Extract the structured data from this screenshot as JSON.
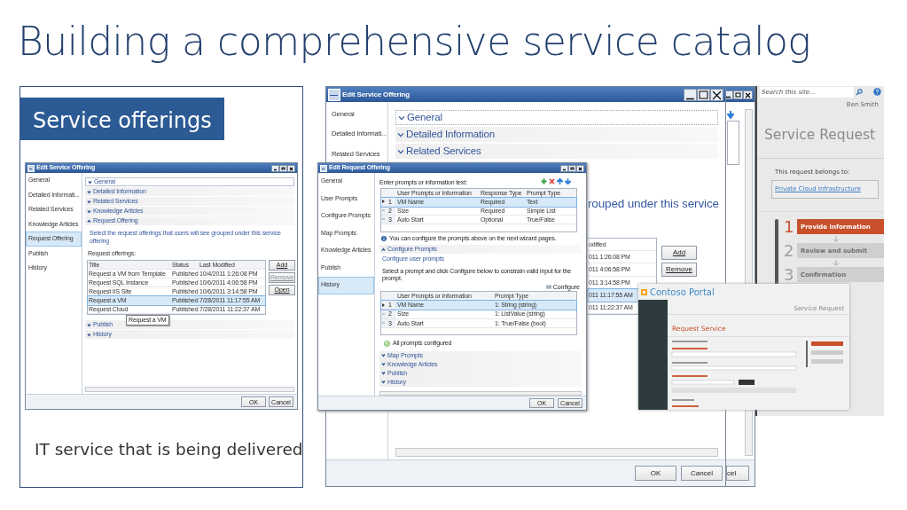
{
  "slide": {
    "title": "Building a comprehensive service catalog"
  },
  "offerings_panel": {
    "heading": "Service offerings",
    "caption": "IT service that is being delivered",
    "window": {
      "title": "Edit Service Offering",
      "nav": [
        {
          "label": "General",
          "selected": false
        },
        {
          "label": "Detailed Informati...",
          "selected": false
        },
        {
          "label": "Related Services",
          "selected": false
        },
        {
          "label": "Knowledge Articles",
          "selected": false
        },
        {
          "label": "Request Offering",
          "selected": true
        },
        {
          "label": "Publish",
          "selected": false
        },
        {
          "label": "History",
          "selected": false
        }
      ],
      "sections": [
        {
          "label": "General",
          "expanded": false
        },
        {
          "label": "Detailed Information",
          "expanded": false
        },
        {
          "label": "Related Services",
          "expanded": false
        },
        {
          "label": "Knowledge Articles",
          "expanded": false
        },
        {
          "label": "Request Offering",
          "expanded": true
        },
        {
          "label": "Publish",
          "expanded": false
        },
        {
          "label": "History",
          "expanded": false
        }
      ],
      "description": "Select the request offerings that users will see grouped under this service offering",
      "list_label": "Request offerings:",
      "columns": [
        "Title",
        "Status",
        "Last Modified"
      ],
      "rows": [
        {
          "cells": [
            "Request a VM from Template",
            "Published",
            "10/4/2011 1:26:08 PM"
          ],
          "selected": false
        },
        {
          "cells": [
            "Request SQL Instance",
            "Published",
            "10/6/2011 4:06:58 PM"
          ],
          "selected": false
        },
        {
          "cells": [
            "Request IIS Site",
            "Published",
            "10/6/2011 3:14:58 PM"
          ],
          "selected": false
        },
        {
          "cells": [
            "Request a VM",
            "Published",
            "7/28/2011 11:17:55 AM"
          ],
          "selected": true
        },
        {
          "cells": [
            "Request Cloud",
            "Published",
            "7/28/2011 11:22:37 AM"
          ],
          "selected": false
        }
      ],
      "tooltip": "Request a VM",
      "buttons": [
        {
          "label": "Add",
          "disabled": false
        },
        {
          "label": "Remove",
          "disabled": true
        },
        {
          "label": "Open",
          "disabled": false
        }
      ],
      "dialog_buttons": [
        "OK",
        "Cancel"
      ]
    }
  },
  "service_window": {
    "title": "Edit Service Offering",
    "nav": [
      {
        "label": "General",
        "selected": false
      },
      {
        "label": "Detailed Informati...",
        "selected": false
      },
      {
        "label": "Related Services",
        "selected": false
      }
    ],
    "sections": [
      {
        "label": "General",
        "expanded": false
      },
      {
        "label": "Detailed Information",
        "expanded": false
      },
      {
        "label": "Related Services",
        "expanded": false
      }
    ],
    "description_fragment": "rouped under this service",
    "column_fragment": "odified",
    "rows": [
      {
        "text": "011 1:26:08 PM",
        "selected": false
      },
      {
        "text": "011 4:06:58 PM",
        "selected": false
      },
      {
        "text": "011 3:14:58 PM",
        "selected": false
      },
      {
        "text": "011 11:17:55 AM",
        "selected": true
      },
      {
        "text": "011 11:22:37 AM",
        "selected": false
      }
    ],
    "buttons": [
      "Add",
      "Remove"
    ],
    "dialog_buttons": [
      "OK",
      "Cancel"
    ]
  },
  "back_window": {
    "button_fragment": "cel"
  },
  "portal": {
    "search_placeholder": "Search this site...",
    "user": "Ben Smith",
    "heading": "Service Request",
    "belongs_label": "This request belongs to:",
    "belongs_link": "Private Cloud Infrastructure",
    "steps": [
      {
        "number": "1",
        "label": "Provide information",
        "selected": true
      },
      {
        "number": "2",
        "label": "Review and submit",
        "selected": false
      },
      {
        "number": "3",
        "label": "Confirmation",
        "selected": false
      }
    ]
  },
  "request_window": {
    "title": "Edit Request Offering",
    "nav": [
      {
        "label": "General",
        "selected": false
      },
      {
        "label": "User Prompts",
        "selected": false
      },
      {
        "label": "Configure Prompts",
        "selected": false
      },
      {
        "label": "Map Prompts",
        "selected": false
      },
      {
        "label": "Knowledge Articles",
        "selected": false
      },
      {
        "label": "Publish",
        "selected": false
      },
      {
        "label": "History",
        "selected": true
      }
    ],
    "prompts_label": "Enter prompts or information text:",
    "prompt_columns": [
      "User Prompts or Information",
      "Response Type",
      "Prompt Type"
    ],
    "prompt_rows": [
      {
        "number": "1",
        "cells": [
          "VM Name",
          "Required",
          "Text"
        ],
        "selected": true
      },
      {
        "number": "2",
        "cells": [
          "Size",
          "Required",
          "Simple List"
        ],
        "selected": false
      },
      {
        "number": "3",
        "cells": [
          "Auto Start",
          "Optional",
          "True/False"
        ],
        "selected": false
      }
    ],
    "info": "You can configure the prompts above on the next wizard pages.",
    "sections": [
      {
        "label": "Configure Prompts",
        "expanded": true
      },
      {
        "label": "Map Prompts",
        "expanded": false
      },
      {
        "label": "Knowledge Articles",
        "expanded": false
      },
      {
        "label": "Publish",
        "expanded": false
      },
      {
        "label": "History",
        "expanded": false
      }
    ],
    "configure_heading": "Configure user prompts",
    "configure_text": "Select a prompt and click Configure below to constrain valid input for the prompt.",
    "configure_button": "Configure",
    "config_columns": [
      "User Prompts or Information",
      "Prompt Type"
    ],
    "config_rows": [
      {
        "number": "1",
        "cells": [
          "VM Name",
          "1: String (string)"
        ],
        "selected": true
      },
      {
        "number": "2",
        "cells": [
          "Size",
          "1: ListValue (string)"
        ],
        "selected": false
      },
      {
        "number": "3",
        "cells": [
          "Auto Start",
          "1: True/False (bool)"
        ],
        "selected": false
      }
    ],
    "status": "All prompts configured",
    "dialog_buttons": [
      "OK",
      "Cancel"
    ]
  },
  "contoso_window": {
    "title": "Contoso Portal",
    "header_right": "Service Request",
    "heading": "Request Service"
  }
}
